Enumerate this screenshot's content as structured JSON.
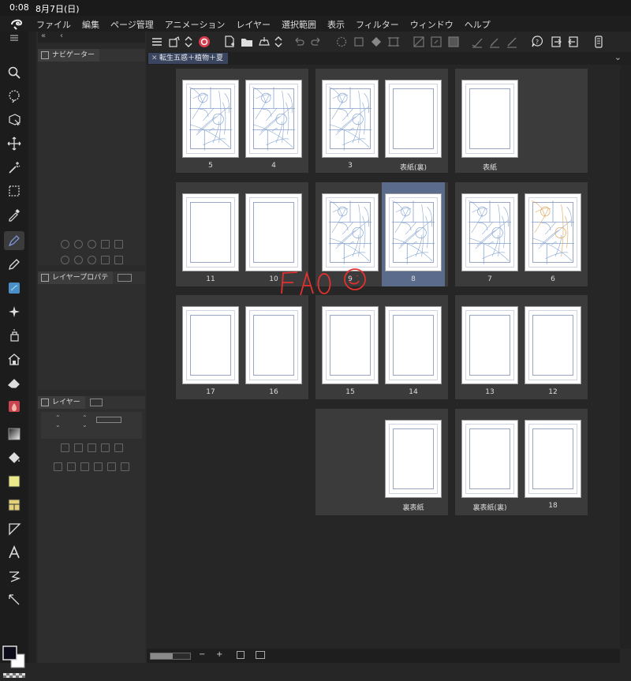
{
  "status": {
    "time": "0:08",
    "date": "8月7日(日)"
  },
  "menu": {
    "items": [
      "ファイル",
      "編集",
      "ページ管理",
      "アニメーション",
      "レイヤー",
      "選択範囲",
      "表示",
      "フィルター",
      "ウィンドウ",
      "ヘルプ"
    ]
  },
  "panels": {
    "navigator": "ナビゲーター",
    "layer_property": "レイヤープロパテ",
    "layer": "レイヤー"
  },
  "document": {
    "tab_title": "転生五惑＋植物＋夏"
  },
  "pages": {
    "rows": [
      {
        "spreads": [
          {
            "pages": [
              {
                "label": "5",
                "content": "sketch"
              },
              {
                "label": "4",
                "content": "sketch"
              }
            ]
          },
          {
            "pages": [
              {
                "label": "3",
                "content": "sketch"
              },
              {
                "label": "表紙(裏)",
                "content": "blank"
              }
            ]
          },
          {
            "pages": [
              {
                "label": "表紙",
                "content": "blank"
              }
            ]
          }
        ]
      },
      {
        "spreads": [
          {
            "pages": [
              {
                "label": "11",
                "content": "blank"
              },
              {
                "label": "10",
                "content": "blank"
              }
            ]
          },
          {
            "pages": [
              {
                "label": "9",
                "content": "sketch"
              },
              {
                "label": "8",
                "content": "sketch",
                "selected": true
              }
            ]
          },
          {
            "pages": [
              {
                "label": "7",
                "content": "sketch"
              },
              {
                "label": "6",
                "content": "sketch-orange"
              }
            ]
          }
        ]
      },
      {
        "spreads": [
          {
            "pages": [
              {
                "label": "17",
                "content": "blank"
              },
              {
                "label": "16",
                "content": "blank"
              }
            ]
          },
          {
            "pages": [
              {
                "label": "15",
                "content": "blank"
              },
              {
                "label": "14",
                "content": "blank"
              }
            ]
          },
          {
            "pages": [
              {
                "label": "13",
                "content": "blank"
              },
              {
                "label": "12",
                "content": "blank"
              }
            ]
          }
        ]
      },
      {
        "spreads": [
          {
            "pages": [
              {
                "label": "裏表紙",
                "content": "blank"
              }
            ]
          },
          {
            "pages": [
              {
                "label": "裏表紙(裏)",
                "content": "blank"
              },
              {
                "label": "18",
                "content": "blank"
              }
            ]
          }
        ]
      }
    ]
  },
  "annotation_text": "FAQ",
  "bottombar": {
    "minus": "−",
    "plus": "+",
    "zoom_level": 0.55
  },
  "colors": {
    "selected_page_bg": "#5b6b8c",
    "tab_bg": "#3a4660",
    "sketch_blue": "#6f93c8",
    "sketch_orange": "#d9913a",
    "scribble_red": "#e0322f",
    "pen_tool": "#4a5ea8"
  },
  "icons": [
    "logo-icon",
    "search-icon",
    "lasso-icon",
    "object-select-icon",
    "move-icon",
    "magic-wand-icon",
    "marquee-icon",
    "eyedropper-icon",
    "pen-icon",
    "pencil-icon",
    "watercolor-icon",
    "sparkle-icon",
    "airbrush-icon",
    "decoration-icon",
    "eraser-icon",
    "blend-icon",
    "gradient-icon",
    "fill-icon",
    "figure-icon",
    "frame-icon",
    "ruler-icon",
    "text-icon",
    "balloon-icon",
    "line-correction-icon"
  ]
}
